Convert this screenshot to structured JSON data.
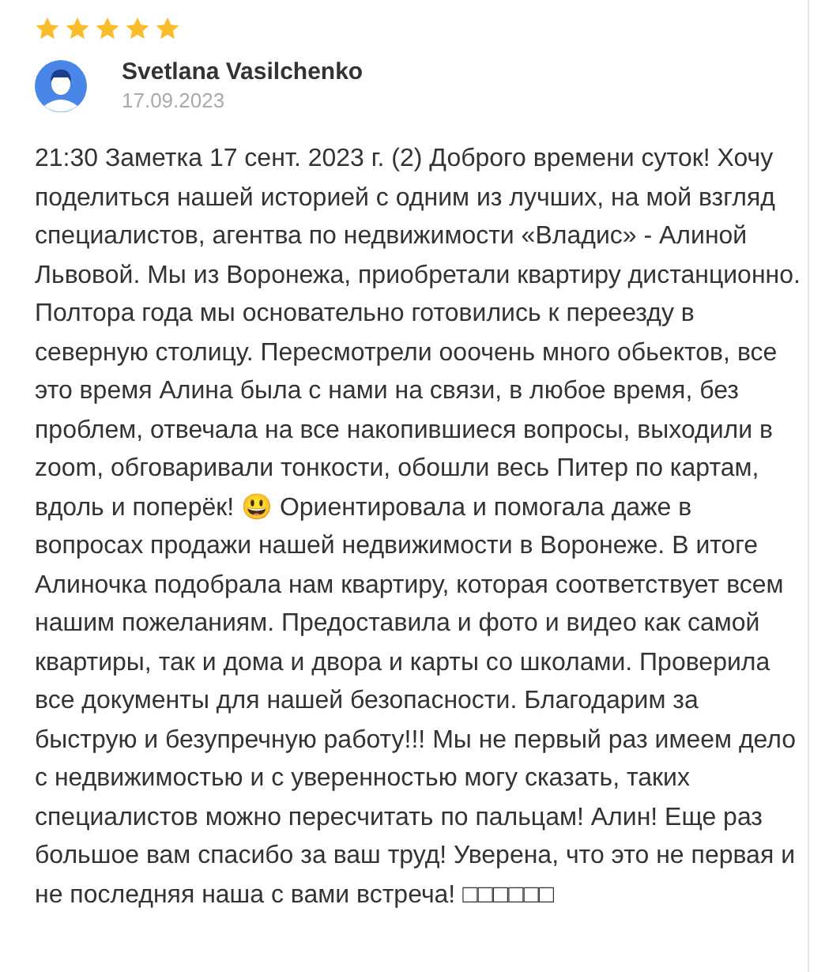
{
  "review": {
    "stars": 5,
    "author": "Svetlana Vasilchenko",
    "date": "17.09.2023",
    "text": "21:30 Заметка 17 сент. 2023 г. (2) Доброго времени суток! Хочу поделиться нашей историей с одним из лучших, на мой взгляд специалистов, агентва по недвижимости «Владис» - Алиной Львовой. Мы из Воронежа, приобретали квартиру дистанционно. Полтора года мы основательно готовились к переезду в северную столицу. Пересмотрели ооочень много обьектов, все это время Алина была с нами на связи, в любое время, без проблем, отвечала на все накопившиеся вопросы, выходили в zoom, обговаривали тонкости, обошли весь Питер по картам, вдоль и поперёк! 😃 Ориентировала и помогала даже в вопросах продажи нашей недвижимости в Воронеже. В итоге Алиночка подобрала нам квартиру, которая соответствует всем нашим пожеланиям. Предоставила и фото и видео как самой квартиры, так и дома и двора и карты со школами. Проверила все документы для нашей безопасности. Благодарим за быструю и безупречную работу!!! Мы не первый раз имеем дело с недвижимостью и с уверенностью могу сказать, таких специалистов можно пересчитать по пальцам! Алин! Еще раз большое вам спасибо за ваш труд! Уверена, что это не первая и не последняя наша с вами встреча! □□□□□□"
  }
}
